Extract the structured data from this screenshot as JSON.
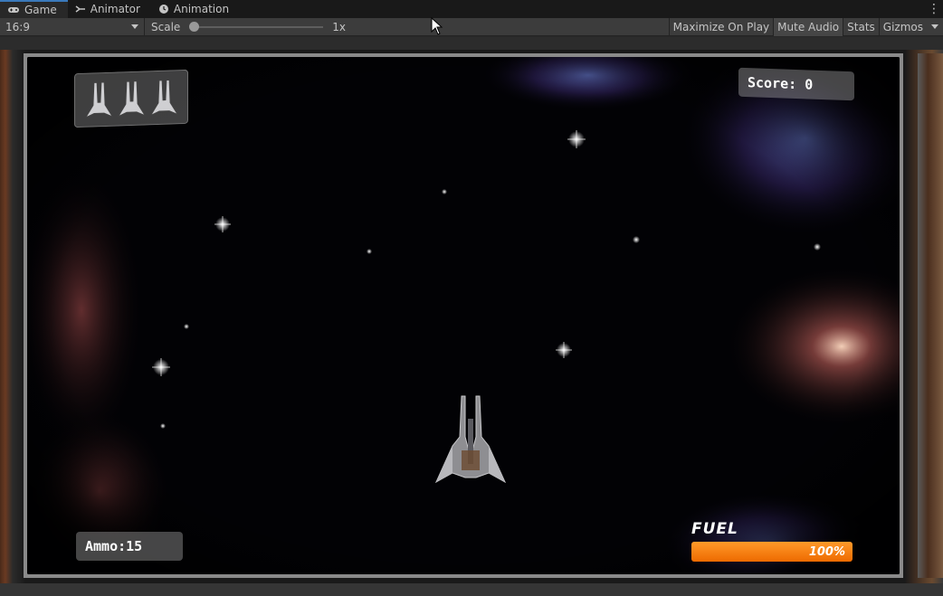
{
  "tabs": [
    {
      "label": "Game",
      "icon": "gamepad-icon",
      "active": true
    },
    {
      "label": "Animator",
      "icon": "animator-icon",
      "active": false
    },
    {
      "label": "Animation",
      "icon": "clock-icon",
      "active": false
    }
  ],
  "toolbar": {
    "aspect": "16:9",
    "scale_label": "Scale",
    "scale_value": "1x",
    "scale_position": 0.0,
    "maximize_on_play": "Maximize On Play",
    "mute_audio": "Mute Audio",
    "stats": "Stats",
    "gizmos": "Gizmos"
  },
  "hud": {
    "score": "Score: 0",
    "ammo": "Ammo:15",
    "fuel_label": "FUEL",
    "fuel_percent_text": "100%",
    "fuel_level": 1.0,
    "lives": 3
  },
  "colors": {
    "accent_tab": "#3a79bb",
    "fuel": "#ff8a1a",
    "background": "#282828"
  }
}
